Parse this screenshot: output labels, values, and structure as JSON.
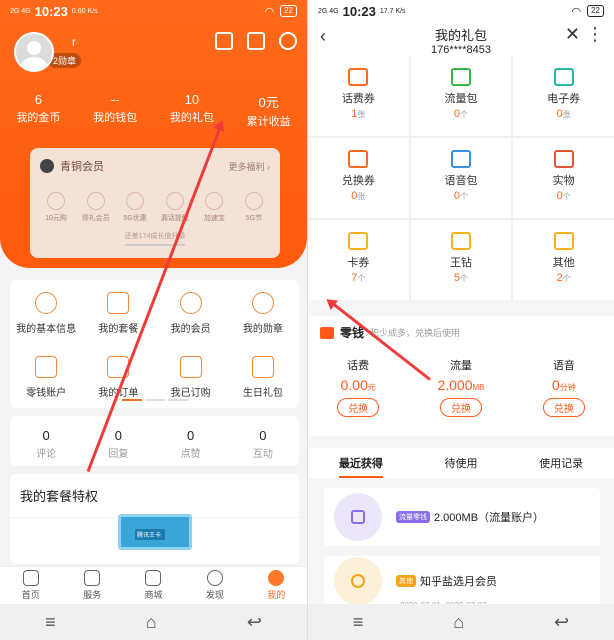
{
  "colors": {
    "accent": "#ff6a1a",
    "arrow": "#ee3b3b"
  },
  "left": {
    "status": {
      "net": "2G 4G",
      "time": "10:23",
      "speed": "0.60 K/s",
      "battery": "22"
    },
    "profile": {
      "name": "r",
      "badge": "2勋章"
    },
    "stats": [
      {
        "num": "6",
        "label": "我的金币"
      },
      {
        "num": "--",
        "label": "我的钱包"
      },
      {
        "num": "10",
        "label": "我的礼包"
      },
      {
        "num": "0元",
        "label": "累计收益"
      }
    ],
    "vip": {
      "name": "青铜会员",
      "more": "更多福利 ›",
      "tip": "还差174成长值升级",
      "perks": [
        "10元购",
        "领礼会员",
        "5G优惠",
        "漏话提醒",
        "加速宝",
        "5G节"
      ]
    },
    "menu": [
      "我的基本信息",
      "我的套餐",
      "我的会员",
      "我的勋章",
      "零钱账户",
      "我的订单",
      "我已订购",
      "生日礼包"
    ],
    "counts": [
      {
        "num": "0",
        "label": "评论"
      },
      {
        "num": "0",
        "label": "回复"
      },
      {
        "num": "0",
        "label": "点赞"
      },
      {
        "num": "0",
        "label": "互动"
      }
    ],
    "package_title": "我的套餐特权",
    "card_text": "腾讯王卡",
    "tabs": [
      "首页",
      "服务",
      "商城",
      "发现",
      "我的"
    ]
  },
  "right": {
    "status": {
      "net": "2G 4G",
      "time": "10:23",
      "speed": "17.7 K/s",
      "battery": "22"
    },
    "title": "我的礼包",
    "phone": "176****8453",
    "coupons": [
      {
        "name": "话费券",
        "count": "1",
        "unit": "张",
        "color": "#ff6a1a"
      },
      {
        "name": "流量包",
        "count": "0",
        "unit": "个",
        "color": "#39b54a"
      },
      {
        "name": "电子券",
        "count": "0",
        "unit": "张",
        "color": "#2bb7a8"
      },
      {
        "name": "兑换券",
        "count": "0",
        "unit": "张",
        "color": "#ff6a1a"
      },
      {
        "name": "语音包",
        "count": "0",
        "unit": "个",
        "color": "#3a8ee6"
      },
      {
        "name": "实物",
        "count": "0",
        "unit": "个",
        "color": "#e0553a"
      },
      {
        "name": "卡券",
        "count": "7",
        "unit": "个",
        "color": "#f6b21a"
      },
      {
        "name": "王钻",
        "count": "5",
        "unit": "个",
        "color": "#f6b21a"
      },
      {
        "name": "其他",
        "count": "2",
        "unit": "个",
        "color": "#f6b21a"
      }
    ],
    "change": {
      "title": "零钱",
      "sub": "积少成多，兑换后使用",
      "items": [
        {
          "label": "话费",
          "value": "0.00",
          "unit": "元",
          "btn": "兑换"
        },
        {
          "label": "流量",
          "value": "2.000",
          "unit": "MB",
          "btn": "兑换"
        },
        {
          "label": "语音",
          "value": "0",
          "unit": "分钟",
          "btn": "兑换"
        }
      ]
    },
    "tabs": [
      "最近获得",
      "待使用",
      "使用记录"
    ],
    "records": [
      {
        "tag": "流量零钱",
        "text": "2.000MB（流量账户）",
        "tagColor": "#8a6cf0",
        "bubble": "#ece6fb",
        "icon": "#8a6cf0"
      },
      {
        "tag": "其他",
        "text": "知乎盐选月会员",
        "tagColor": "#f6a21a",
        "bubble": "#fdf0d9",
        "icon": "#f6a21a",
        "date": "2020-07-01~2020-07-07"
      }
    ]
  }
}
